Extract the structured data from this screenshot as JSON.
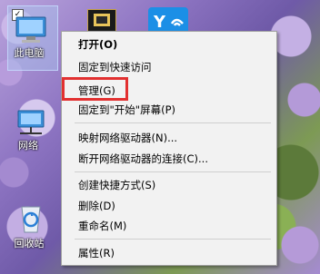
{
  "desktop": {
    "icons": [
      {
        "label": "此电脑"
      },
      {
        "label": "网络"
      },
      {
        "label": "回收站"
      }
    ]
  },
  "context_menu": {
    "items": [
      {
        "label": "打开(O)",
        "bold": true
      },
      {
        "label": "固定到快速访问"
      },
      {
        "label": "管理(G)",
        "highlighted": true
      },
      {
        "label": "固定到\"开始\"屏幕(P)"
      },
      {
        "label": "映射网络驱动器(N)..."
      },
      {
        "label": "断开网络驱动器的连接(C)..."
      },
      {
        "label": "创建快捷方式(S)"
      },
      {
        "label": "删除(D)"
      },
      {
        "label": "重命名(M)"
      },
      {
        "label": "属性(R)"
      }
    ]
  },
  "colors": {
    "highlight_border": "#e23030",
    "menu_background": "#f2f2f2"
  }
}
